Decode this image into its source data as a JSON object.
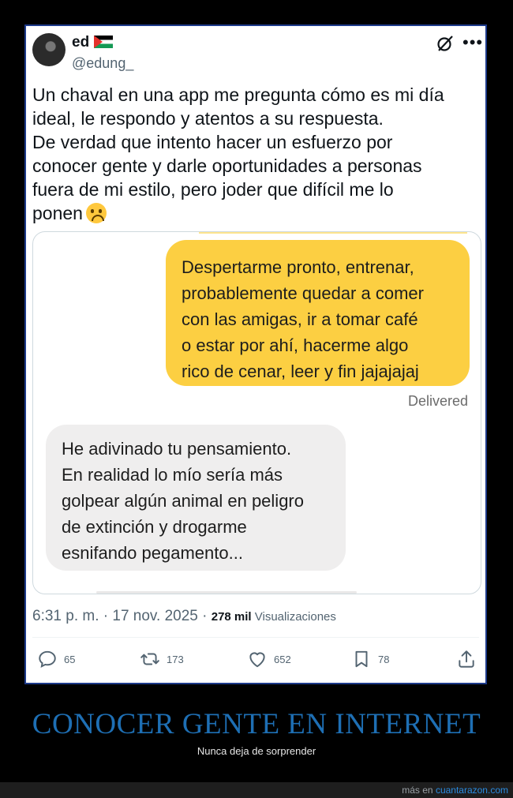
{
  "tweet": {
    "display_name": "ed",
    "handle": "@edung_",
    "text_lines": "Un chaval en una app me pregunta cómo es mi día\nideal, le respondo y atentos a su respuesta.\nDe verdad que intento hacer un esfuerzo por\nconocer gente y darle oportunidades a personas\nfuera de mi estilo, pero joder que difícil me lo\nponen",
    "time": "6:31 p. m. · 17 nov. 2025 · ",
    "views_count": "278 mil",
    "views_label": " Visualizaciones",
    "replies": "65",
    "retweets": "173",
    "likes": "652",
    "bookmarks": "78"
  },
  "chat": {
    "sent_message": "Despertarme pronto, entrenar,\nprobablemente quedar a comer\ncon las amigas, ir a tomar café\no estar por ahí, hacerme algo\nrico de cenar, leer y fin jajajajaj",
    "status": "Delivered",
    "received_message": "He adivinado tu pensamiento.\nEn realidad lo mío sería más\ngolpear algún animal en peligro\nde extinción y drogarme\nesnifando pegamento..."
  },
  "caption": {
    "title": "CONOCER GENTE EN INTERNET",
    "subtitle": "Nunca deja de sorprender"
  },
  "footer": {
    "prefix": "más en ",
    "site": "cuantarazon.com"
  },
  "colors": {
    "sent_bubble": "#fccf42",
    "received_bubble": "#efeeee",
    "title": "#1e6fb4",
    "link": "#2a8be0"
  },
  "icons": [
    "grok-icon",
    "more-icon",
    "reply-icon",
    "retweet-icon",
    "like-icon",
    "bookmark-icon",
    "share-icon",
    "upside-down-face-emoji",
    "palestine-flag"
  ]
}
